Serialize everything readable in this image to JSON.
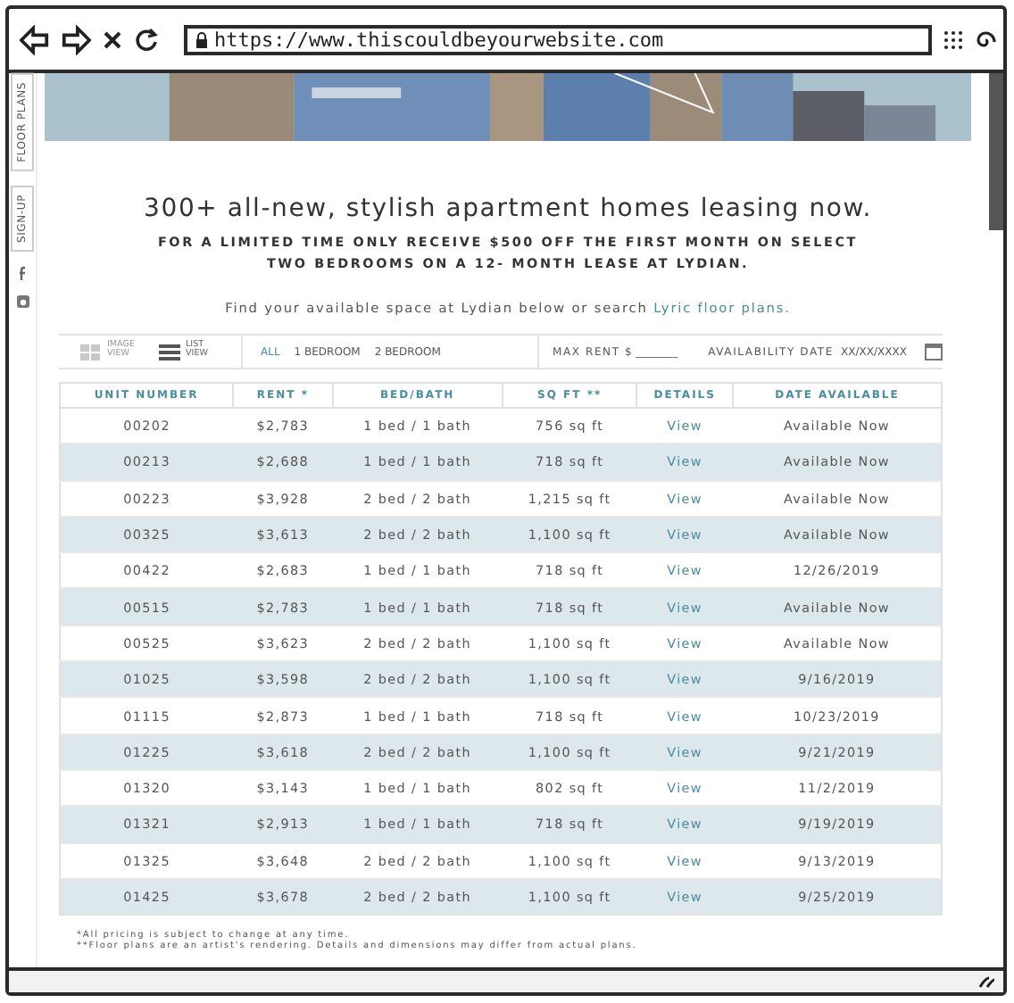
{
  "browser": {
    "url": "https://www.thiscouldbeyourwebsite.com"
  },
  "side_tabs": [
    {
      "label": "FLOOR PLANS"
    },
    {
      "label": "SIGN-UP"
    }
  ],
  "heading": "300+ all-new, stylish apartment homes leasing now.",
  "promo_lines": [
    "FOR A LIMITED TIME ONLY RECEIVE $500 OFF THE FIRST MONTH ON SELECT",
    "TWO BEDROOMS ON A 12- MONTH LEASE AT LYDIAN."
  ],
  "search_text": {
    "text": "Find your available space at Lydian below or search ",
    "link": "Lyric floor plans."
  },
  "view_toggles": [
    {
      "kind": "grid",
      "label": "IMAGE VIEW",
      "selected": false
    },
    {
      "kind": "list",
      "label": "LIST VIEW",
      "selected": true
    }
  ],
  "bedroom_filters": [
    {
      "label": "ALL",
      "selected": true
    },
    {
      "label": "1 BEDROOM",
      "selected": false
    },
    {
      "label": "2 BEDROOM",
      "selected": false
    }
  ],
  "max_rent": {
    "label": "MAX RENT $",
    "placeholder": "________"
  },
  "availability_date": {
    "label": "AVAILABILITY DATE",
    "placeholder": "XX/XX/XXXX"
  },
  "table": {
    "columns": [
      "UNIT NUMBER",
      "RENT *",
      "BED/BATH",
      "SQ FT **",
      "DETAILS",
      "DATE AVAILABLE"
    ],
    "rows": [
      [
        "00202",
        "$2,783",
        "1 bed / 1 bath",
        "756 sq ft",
        "View",
        "Available Now"
      ],
      [
        "00213",
        "$2,688",
        "1 bed / 1 bath",
        "718 sq ft",
        "View",
        "Available Now"
      ],
      [
        "00223",
        "$3,928",
        "2 bed / 2 bath",
        "1,215 sq ft",
        "View",
        "Available Now"
      ],
      [
        "00325",
        "$3,613",
        "2 bed / 2 bath",
        "1,100 sq ft",
        "View",
        "Available Now"
      ],
      [
        "00422",
        "$2,683",
        "1 bed / 1 bath",
        "718 sq ft",
        "View",
        "12/26/2019"
      ],
      [
        "00515",
        "$2,783",
        "1 bed / 1 bath",
        "718 sq ft",
        "View",
        "Available Now"
      ],
      [
        "00525",
        "$3,623",
        "2 bed / 2 bath",
        "1,100 sq ft",
        "View",
        "Available Now"
      ],
      [
        "01025",
        "$3,598",
        "2 bed / 2 bath",
        "1,100 sq ft",
        "View",
        "9/16/2019"
      ],
      [
        "01115",
        "$2,873",
        "1 bed / 1 bath",
        "718 sq ft",
        "View",
        "10/23/2019"
      ],
      [
        "01225",
        "$3,618",
        "2 bed / 2 bath",
        "1,100 sq ft",
        "View",
        "9/21/2019"
      ],
      [
        "01320",
        "$3,143",
        "1 bed / 1 bath",
        "802 sq ft",
        "View",
        "11/2/2019"
      ],
      [
        "01321",
        "$2,913",
        "1 bed / 1 bath",
        "718 sq ft",
        "View",
        "9/19/2019"
      ],
      [
        "01325",
        "$3,648",
        "2 bed / 2 bath",
        "1,100 sq ft",
        "View",
        "9/13/2019"
      ],
      [
        "01425",
        "$3,678",
        "2 bed / 2 bath",
        "1,100 sq ft",
        "View",
        "9/25/2019"
      ]
    ]
  },
  "footnotes": [
    "*All pricing is subject to change at any time.",
    "**Floor plans are an artist's rendering. Details and dimensions may differ from actual plans."
  ]
}
